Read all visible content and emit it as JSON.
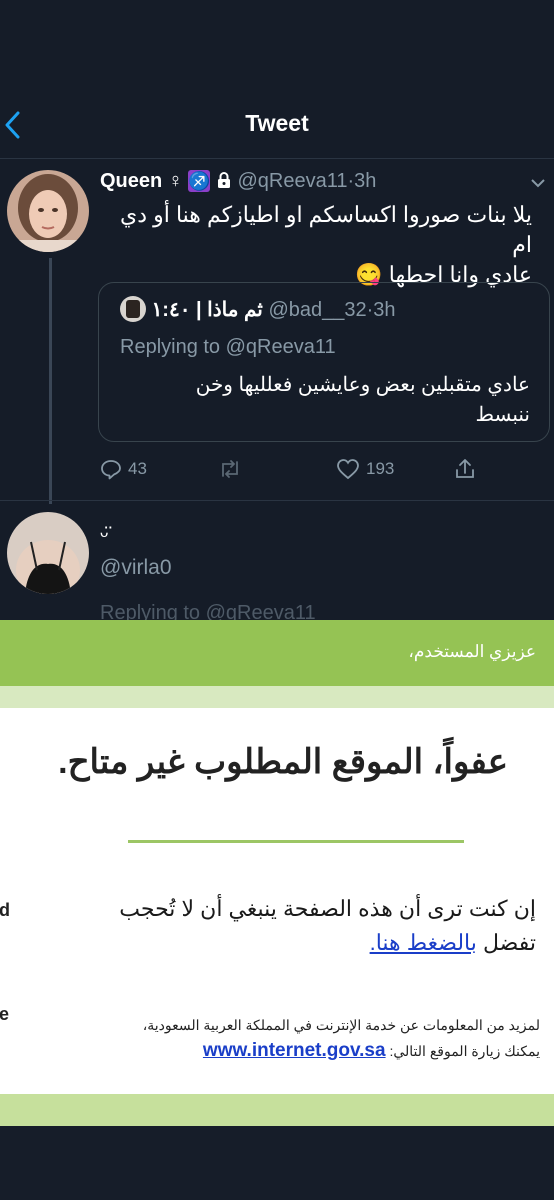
{
  "header": {
    "title": "Tweet"
  },
  "tweet": {
    "name": "Queen",
    "female_symbol": "♀",
    "zodiac": "♐",
    "lock": "🔒",
    "handle": "@qReeva11",
    "time": "3h",
    "text_line1": "يلا بنات صوروا اكساسكم او اطيازكم هنا أو دي ام",
    "text_line2": "عادي وانا احطها 😋",
    "quote": {
      "name": "ثم ماذا | ١:٤٠",
      "handle": "@bad__32",
      "time": "3h",
      "replying": "Replying to @qReeva11",
      "text_line1": "عادي متقبلين بعض وعايشين فعلليها وخن",
      "text_line2": "ننبسط"
    },
    "actions": {
      "replies": "43",
      "retweets": "",
      "likes": "193"
    }
  },
  "reply": {
    "name": "ᵕ̈",
    "handle": "@virla0",
    "replying": "Replying to @qReeva11"
  },
  "block_page": {
    "greeting": "عزيزي المستخدم،",
    "title": "عفواً، الموقع المطلوب غير متاح.",
    "msg_line1": "إن كنت ترى أن هذه الصفحة ينبغي أن لا تُحجب",
    "msg_line2_prefix": "تفضل",
    "msg_link": "بالضغط هنا.",
    "info_line1": "لمزيد من المعلومات عن خدمة الإنترنت في المملكة العربية السعودية،",
    "info_line2": "يمكنك زيارة الموقع التالي:",
    "info_link": "www.internet.gov.sa",
    "cut_left_1": "d",
    "cut_left_2": "e"
  },
  "colors": {
    "bg": "#151c28",
    "accent": "#1da1f2",
    "banner": "#95c354"
  }
}
